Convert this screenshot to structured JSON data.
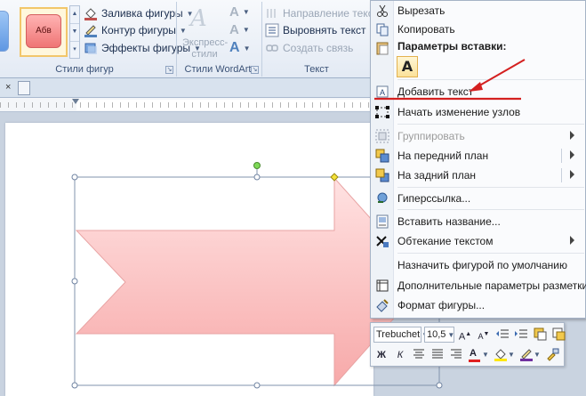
{
  "ribbon": {
    "shape_style_sample": "Абв",
    "fill_label": "Заливка фигуры",
    "outline_label": "Контур фигуры",
    "effects_label": "Эффекты фигуры",
    "group_shape_styles": "Стили фигур",
    "express_styles_label": "Экспресс-стили",
    "group_wordart": "Стили WordArt",
    "text_direction_label": "Направление текста",
    "align_text_label": "Выровнять текст",
    "create_link_label": "Создать связь",
    "group_text": "Текст"
  },
  "document": {
    "tab_close": "×",
    "shape_fill_top": "#ffe2e2",
    "shape_fill_bottom": "#f7a9a9",
    "shape_stroke": "#e8a3a3"
  },
  "context_menu": {
    "cut": "Вырезать",
    "copy": "Копировать",
    "paste_header": "Параметры вставки:",
    "paste_option": "A",
    "add_text": "Добавить текст",
    "edit_points": "Начать изменение узлов",
    "group": "Группировать",
    "bring_front": "На передний план",
    "send_back": "На задний план",
    "hyperlink": "Гиперссылка...",
    "insert_caption": "Вставить название...",
    "wrap_text": "Обтекание текстом",
    "set_default": "Назначить фигурой по умолчанию",
    "more_layout": "Дополнительные параметры разметки...",
    "format_shape": "Формат фигуры..."
  },
  "mini_toolbar": {
    "font_name": "Trebuchet",
    "font_size": "10,5",
    "bold": "Ж",
    "italic": "К",
    "font_color_letter": "A"
  },
  "colors": {
    "annotation_red": "#d42020",
    "font_color_red": "#e02020",
    "highlight_yellow": "#ffe800"
  }
}
